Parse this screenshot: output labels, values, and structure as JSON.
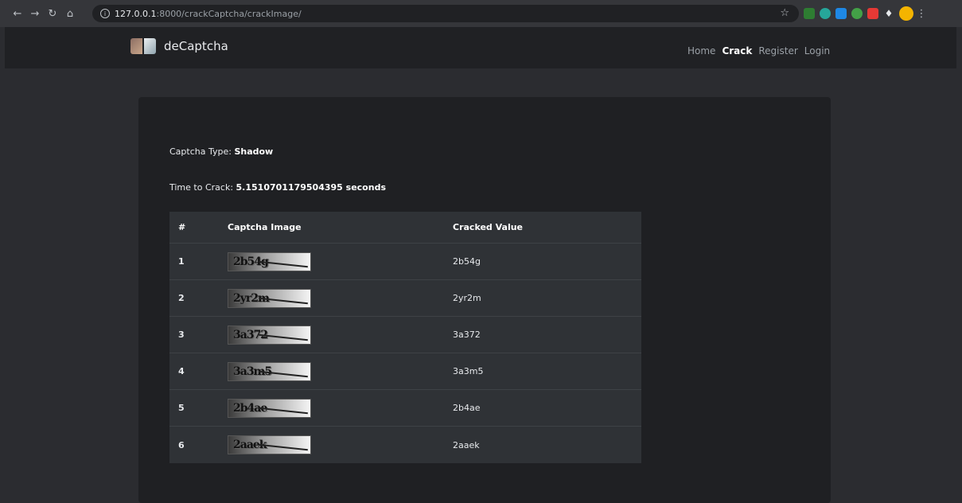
{
  "browser": {
    "url_host": "127.0.0.1",
    "url_rest": ":8000/crackCaptcha/crackImage/"
  },
  "navbar": {
    "brand": "deCaptcha",
    "links": [
      "Home",
      "Crack",
      "Register",
      "Login"
    ],
    "active": "Crack"
  },
  "info": {
    "type_label": "Captcha Type: ",
    "type_value": "Shadow",
    "time_label": "Time to Crack: ",
    "time_value": "5.1510701179504395 seconds"
  },
  "table": {
    "headers": [
      "#",
      "Captcha Image",
      "Cracked Value"
    ],
    "rows": [
      {
        "num": "1",
        "image_text": "2b54g",
        "value": "2b54g"
      },
      {
        "num": "2",
        "image_text": "2yr2m",
        "value": "2yr2m"
      },
      {
        "num": "3",
        "image_text": "3a372",
        "value": "3a372"
      },
      {
        "num": "4",
        "image_text": "3a3m5",
        "value": "3a3m5"
      },
      {
        "num": "5",
        "image_text": "2b4ae",
        "value": "2b4ae"
      },
      {
        "num": "6",
        "image_text": "2aaek",
        "value": "2aaek"
      }
    ]
  }
}
